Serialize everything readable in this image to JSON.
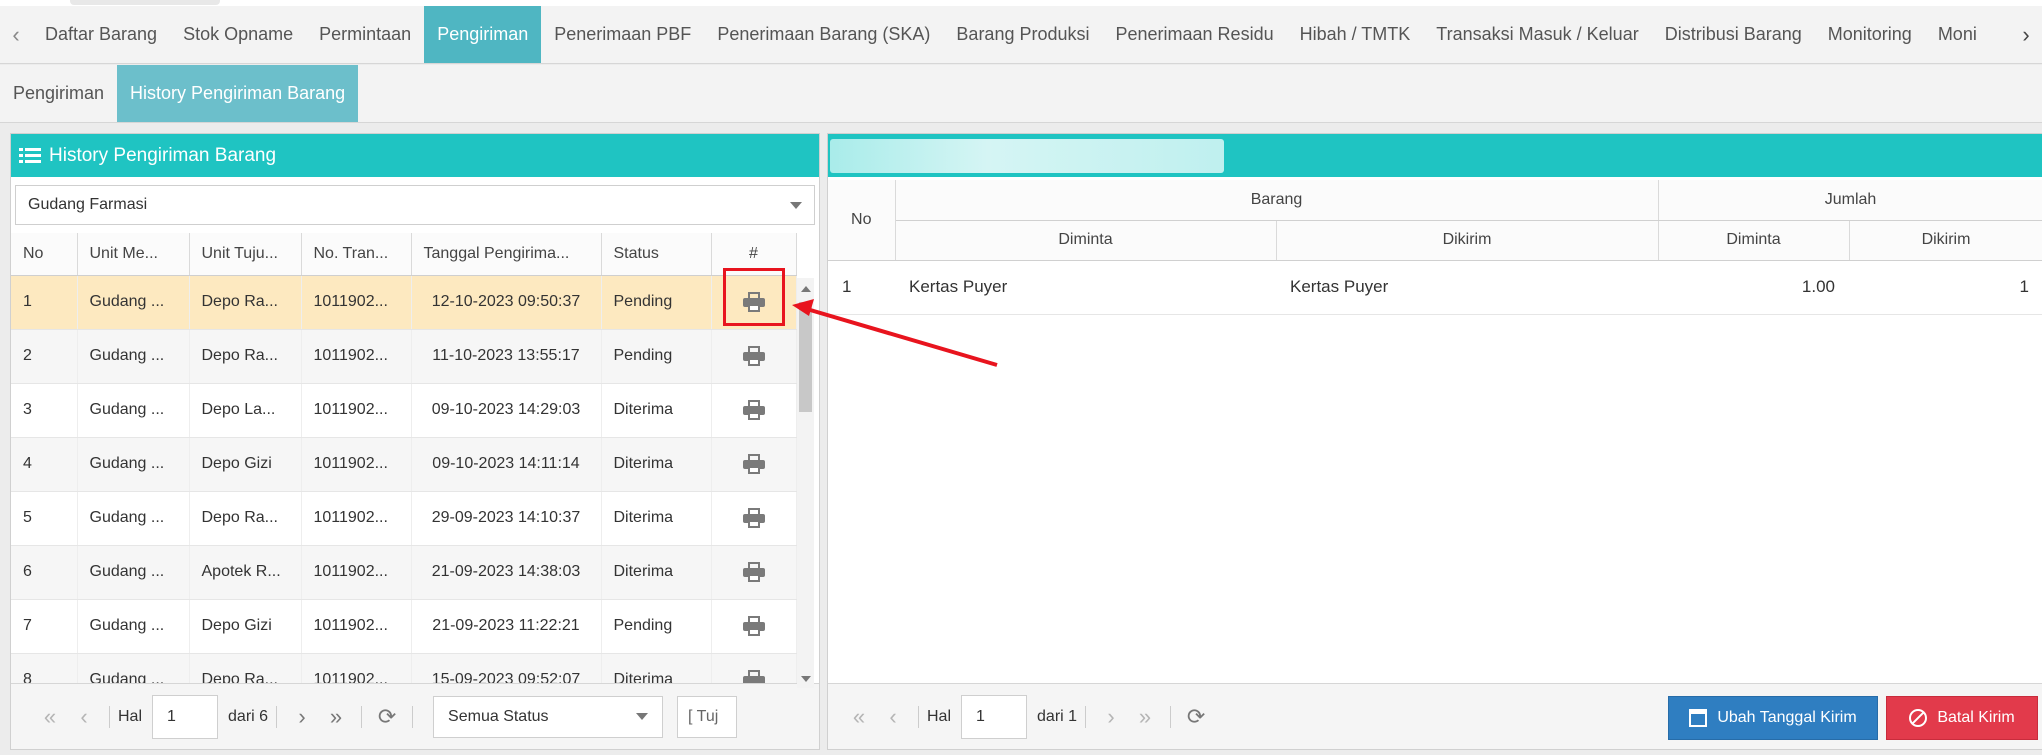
{
  "top_tabs": [
    "Daftar Barang",
    "Stok Opname",
    "Permintaan",
    "Pengiriman",
    "Penerimaan PBF",
    "Penerimaan Barang (SKA)",
    "Barang Produksi",
    "Penerimaan Residu",
    "Hibah / TMTK",
    "Transaksi Masuk / Keluar",
    "Distribusi Barang",
    "Monitoring",
    "Moni"
  ],
  "active_top_tab": "Pengiriman",
  "sub_tabs": [
    "Pengiriman",
    "History Pengiriman Barang"
  ],
  "active_sub_tab": "History Pengiriman Barang",
  "left_panel": {
    "title": "History Pengiriman Barang",
    "gudang_select": "Gudang Farmasi",
    "columns": [
      "No",
      "Unit Me...",
      "Unit Tuju...",
      "No. Tran...",
      "Tanggal Pengirima...",
      "Status",
      "#"
    ],
    "rows": [
      {
        "no": "1",
        "unit_me": "Gudang ...",
        "unit_tuju": "Depo Ra...",
        "no_tran": "1011902...",
        "tanggal": "12-10-2023 09:50:37",
        "status": "Pending"
      },
      {
        "no": "2",
        "unit_me": "Gudang ...",
        "unit_tuju": "Depo Ra...",
        "no_tran": "1011902...",
        "tanggal": "11-10-2023 13:55:17",
        "status": "Pending"
      },
      {
        "no": "3",
        "unit_me": "Gudang ...",
        "unit_tuju": "Depo La...",
        "no_tran": "1011902...",
        "tanggal": "09-10-2023 14:29:03",
        "status": "Diterima"
      },
      {
        "no": "4",
        "unit_me": "Gudang ...",
        "unit_tuju": "Depo Gizi",
        "no_tran": "1011902...",
        "tanggal": "09-10-2023 14:11:14",
        "status": "Diterima"
      },
      {
        "no": "5",
        "unit_me": "Gudang ...",
        "unit_tuju": "Depo Ra...",
        "no_tran": "1011902...",
        "tanggal": "29-09-2023 14:10:37",
        "status": "Diterima"
      },
      {
        "no": "6",
        "unit_me": "Gudang ...",
        "unit_tuju": "Apotek R...",
        "no_tran": "1011902...",
        "tanggal": "21-09-2023 14:38:03",
        "status": "Diterima"
      },
      {
        "no": "7",
        "unit_me": "Gudang ...",
        "unit_tuju": "Depo Gizi",
        "no_tran": "1011902...",
        "tanggal": "21-09-2023 11:22:21",
        "status": "Pending"
      },
      {
        "no": "8",
        "unit_me": "Gudang ...",
        "unit_tuju": "Depo Ra...",
        "no_tran": "1011902...",
        "tanggal": "15-09-2023 09:52:07",
        "status": "Diterima"
      }
    ],
    "pager": {
      "hal_label": "Hal",
      "page": "1",
      "dari_label": "dari 6",
      "status_filter": "Semua Status",
      "tujuan_filter": "[ Tuj"
    }
  },
  "right_panel": {
    "header_groups": {
      "no": "No",
      "barang": "Barang",
      "jumlah": "Jumlah"
    },
    "sub_headers": {
      "barang_diminta": "Diminta",
      "barang_dikirim": "Dikirim",
      "jumlah_diminta": "Diminta",
      "jumlah_dikirim": "Dikirim"
    },
    "rows": [
      {
        "no": "1",
        "diminta": "Kertas Puyer",
        "dikirim": "Kertas Puyer",
        "jumlah_diminta": "1.00",
        "jumlah_dikirim": "1"
      }
    ],
    "pager": {
      "hal_label": "Hal",
      "page": "1",
      "dari_label": "dari 1"
    },
    "btn_ubah": "Ubah Tanggal Kirim",
    "btn_batal": "Batal Kirim"
  },
  "colors": {
    "accent": "#1fc4c2",
    "active_tab": "#4fb6c2",
    "pending": "#e8333a",
    "diterima": "#2b8a2b",
    "highlight": "#e8141e",
    "primary_btn": "#2f7ec1",
    "danger_btn": "#e23a4b"
  }
}
